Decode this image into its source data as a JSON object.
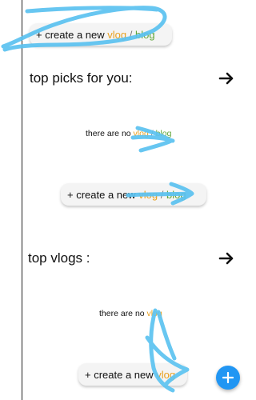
{
  "top_create_button": {
    "prefix": "+ create a new",
    "vlog": "vlog",
    "slash": "/",
    "blog": "blog"
  },
  "top_picks": {
    "title": "top picks for you:",
    "empty": {
      "prefix": "there are no",
      "vlog": "vlog",
      "slash": "/",
      "blog": "blog"
    },
    "create_button": {
      "prefix": "+ create a new",
      "vlog": "vlog",
      "slash": "/",
      "blog": "blog"
    }
  },
  "top_vlogs": {
    "title": "top vlogs :",
    "empty": {
      "prefix": "there are no",
      "vlog": "vlog"
    },
    "create_button": {
      "prefix": "+ create a new",
      "vlog": "vlog"
    }
  },
  "icons": {
    "section_arrow": "arrow-right-icon",
    "fab": "plus-icon"
  },
  "colors": {
    "vlog": "#e8a01f",
    "blog": "#61a63a",
    "fab": "#2196f3",
    "annotation_stroke": "#5bc2f0"
  }
}
